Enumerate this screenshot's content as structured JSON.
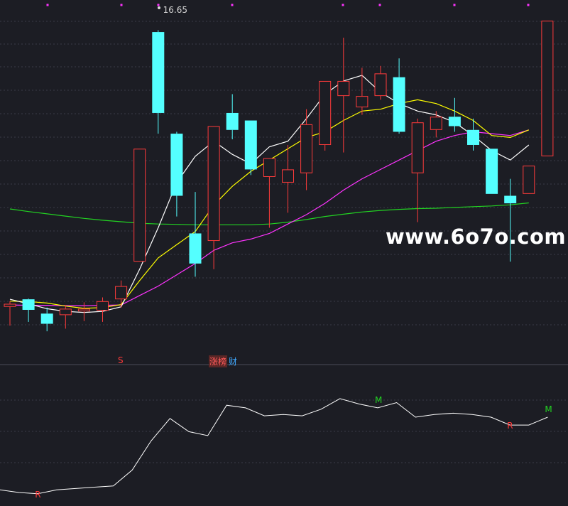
{
  "price_label": "16.65",
  "watermark": "www.6o7o.com",
  "event_tags": {
    "s_mark": "S",
    "zhangting": "涨榜",
    "cai": "财"
  },
  "signals": [
    {
      "text": "R",
      "color": "#ff3b3b"
    },
    {
      "text": "M",
      "color": "#22d322"
    },
    {
      "text": "R",
      "color": "#ff3b3b"
    },
    {
      "text": "M",
      "color": "#22d322"
    }
  ],
  "colors": {
    "up": "#ff3b3b",
    "down": "#54ffff",
    "ma_short": "#ffffff",
    "ma_mid": "#ffff00",
    "ma_long": "#ff33ff",
    "ma_xlong": "#22d322",
    "indicator": "#ffffff"
  },
  "chart_data": [
    {
      "type": "candlestick",
      "ylim": [
        8.2,
        17.3
      ],
      "x": [
        1,
        2,
        3,
        4,
        5,
        6,
        7,
        8,
        9,
        10,
        11,
        12,
        13,
        14,
        15,
        16,
        17,
        18,
        19,
        20,
        21,
        22,
        23,
        24,
        25,
        26,
        27,
        28,
        29
      ],
      "candles": [
        {
          "o": 9.3,
          "h": 9.45,
          "l": 8.8,
          "c": 9.38
        },
        {
          "o": 9.5,
          "h": 9.52,
          "l": 8.9,
          "c": 9.22
        },
        {
          "o": 9.12,
          "h": 9.28,
          "l": 8.65,
          "c": 8.85
        },
        {
          "o": 9.08,
          "h": 9.35,
          "l": 8.72,
          "c": 9.25
        },
        {
          "o": 9.18,
          "h": 9.42,
          "l": 8.92,
          "c": 9.25
        },
        {
          "o": 9.2,
          "h": 9.55,
          "l": 8.9,
          "c": 9.45
        },
        {
          "o": 9.5,
          "h": 10.0,
          "l": 9.28,
          "c": 9.85
        },
        {
          "o": 10.5,
          "h": 13.5,
          "l": 10.5,
          "c": 13.5
        },
        {
          "o": 16.6,
          "h": 16.65,
          "l": 13.9,
          "c": 14.45
        },
        {
          "o": 13.9,
          "h": 13.95,
          "l": 11.7,
          "c": 12.25
        },
        {
          "o": 11.25,
          "h": 12.35,
          "l": 10.1,
          "c": 10.45
        },
        {
          "o": 11.05,
          "h": 14.1,
          "l": 10.3,
          "c": 14.1
        },
        {
          "o": 14.45,
          "h": 14.95,
          "l": 13.75,
          "c": 14.0
        },
        {
          "o": 14.25,
          "h": 14.25,
          "l": 12.8,
          "c": 12.95
        },
        {
          "o": 12.75,
          "h": 13.15,
          "l": 11.4,
          "c": 13.25
        },
        {
          "o": 12.6,
          "h": 13.6,
          "l": 11.8,
          "c": 12.95
        },
        {
          "o": 12.85,
          "h": 14.55,
          "l": 12.4,
          "c": 14.15
        },
        {
          "o": 13.6,
          "h": 15.3,
          "l": 13.45,
          "c": 15.3
        },
        {
          "o": 14.9,
          "h": 16.45,
          "l": 13.4,
          "c": 15.3
        },
        {
          "o": 14.6,
          "h": 15.65,
          "l": 14.4,
          "c": 14.9
        },
        {
          "o": 14.9,
          "h": 15.7,
          "l": 14.8,
          "c": 15.5
        },
        {
          "o": 15.4,
          "h": 15.9,
          "l": 13.9,
          "c": 13.95
        },
        {
          "o": 12.85,
          "h": 14.3,
          "l": 11.55,
          "c": 14.2
        },
        {
          "o": 14.0,
          "h": 14.5,
          "l": 13.8,
          "c": 14.35
        },
        {
          "o": 14.35,
          "h": 14.85,
          "l": 13.95,
          "c": 14.1
        },
        {
          "o": 14.0,
          "h": 14.3,
          "l": 13.45,
          "c": 13.6
        },
        {
          "o": 13.5,
          "h": 13.5,
          "l": 12.3,
          "c": 12.3
        },
        {
          "o": 12.25,
          "h": 12.7,
          "l": 10.5,
          "c": 12.05
        },
        {
          "o": 12.3,
          "h": 13.05,
          "l": 12.3,
          "c": 13.05
        },
        {
          "o": 13.3,
          "h": 16.9,
          "l": 13.3,
          "c": 16.9
        }
      ],
      "ma_short": [
        9.5,
        9.38,
        9.25,
        9.18,
        9.15,
        9.18,
        9.3,
        10.3,
        11.4,
        12.6,
        13.3,
        13.7,
        13.35,
        13.1,
        13.55,
        13.7,
        14.3,
        14.95,
        15.3,
        15.45,
        15.0,
        14.7,
        14.5,
        14.4,
        14.2,
        13.85,
        13.45,
        13.2,
        13.6
      ],
      "ma_mid": [
        9.45,
        9.44,
        9.4,
        9.32,
        9.26,
        9.28,
        9.36,
        10.0,
        10.6,
        10.95,
        11.3,
        12.0,
        12.5,
        12.9,
        13.2,
        13.5,
        13.8,
        13.95,
        14.25,
        14.5,
        14.55,
        14.7,
        14.8,
        14.7,
        14.5,
        14.25,
        13.85,
        13.8,
        14.0
      ],
      "ma_long": [
        9.35,
        9.34,
        9.34,
        9.33,
        9.33,
        9.34,
        9.35,
        9.6,
        9.85,
        10.15,
        10.45,
        10.8,
        11.0,
        11.1,
        11.25,
        11.5,
        11.75,
        12.05,
        12.4,
        12.7,
        12.95,
        13.2,
        13.45,
        13.7,
        13.85,
        13.95,
        13.9,
        13.85,
        14.0
      ],
      "ma_xlong": [
        11.9,
        11.83,
        11.77,
        11.71,
        11.65,
        11.6,
        11.56,
        11.52,
        11.5,
        11.49,
        11.48,
        11.48,
        11.48,
        11.48,
        11.5,
        11.55,
        11.62,
        11.7,
        11.76,
        11.82,
        11.86,
        11.89,
        11.91,
        11.92,
        11.94,
        11.96,
        11.98,
        12.01,
        12.06
      ]
    },
    {
      "type": "line",
      "ylim": [
        0,
        100
      ],
      "x": [
        1,
        2,
        3,
        4,
        5,
        6,
        7,
        8,
        9,
        10,
        11,
        12,
        13,
        14,
        15,
        16,
        17,
        18,
        19,
        20,
        21,
        22,
        23,
        24,
        25,
        26,
        27,
        28,
        29,
        30
      ],
      "values": [
        9,
        7,
        6,
        9,
        10,
        11,
        12,
        24,
        46,
        63,
        53,
        50,
        73,
        71,
        65,
        66,
        65,
        70,
        78,
        74,
        71,
        75,
        64,
        66,
        67,
        66,
        64,
        58,
        58,
        64
      ],
      "signal_points": [
        {
          "i": 2,
          "text": "R",
          "color": "#ff3b3b"
        },
        {
          "i": 20,
          "text": "M",
          "color": "#22d322"
        },
        {
          "i": 27,
          "text": "R",
          "color": "#ff3b3b"
        },
        {
          "i": 29,
          "text": "M",
          "color": "#22d322"
        }
      ]
    }
  ]
}
